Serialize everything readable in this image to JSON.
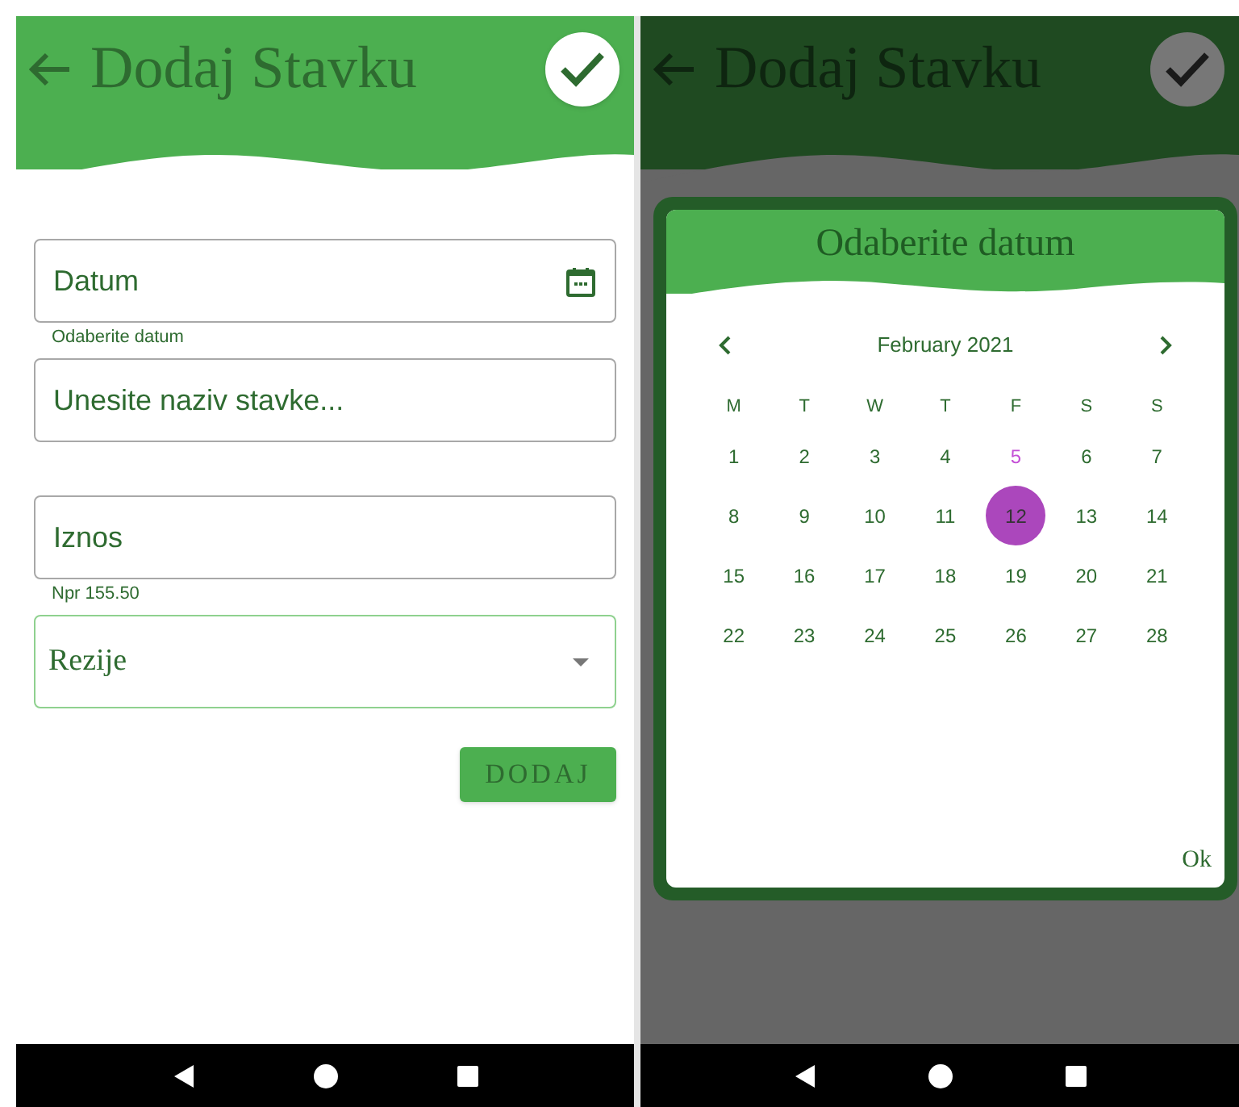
{
  "form_screen": {
    "header": {
      "title": "Dodaj Stavku"
    },
    "fields": [
      {
        "kind": "date",
        "label": "Datum",
        "helper": "Odaberite datum"
      },
      {
        "kind": "text",
        "placeholder": "Unesite naziv stavke..."
      },
      {
        "kind": "text",
        "label": "Iznos",
        "helper": "Npr 155.50"
      },
      {
        "kind": "select",
        "value": "Rezije"
      }
    ],
    "submit_button": "DODAJ"
  },
  "dialog_screen": {
    "header": {
      "title": "Dodaj Stavku"
    },
    "dialog": {
      "title": "Odaberite datum",
      "month": "February 2021",
      "weekdays": [
        "M",
        "T",
        "W",
        "T",
        "F",
        "S",
        "S"
      ],
      "days": [
        {
          "label": "1",
          "today": false,
          "selected": false
        },
        {
          "label": "2",
          "today": false,
          "selected": false
        },
        {
          "label": "3",
          "today": false,
          "selected": false
        },
        {
          "label": "4",
          "today": false,
          "selected": false
        },
        {
          "label": "5",
          "today": true,
          "selected": false
        },
        {
          "label": "6",
          "today": false,
          "selected": false
        },
        {
          "label": "7",
          "today": false,
          "selected": false
        },
        {
          "label": "8",
          "today": false,
          "selected": false
        },
        {
          "label": "9",
          "today": false,
          "selected": false
        },
        {
          "label": "10",
          "today": false,
          "selected": false
        },
        {
          "label": "11",
          "today": false,
          "selected": false
        },
        {
          "label": "12",
          "today": false,
          "selected": true
        },
        {
          "label": "13",
          "today": false,
          "selected": false
        },
        {
          "label": "14",
          "today": false,
          "selected": false
        },
        {
          "label": "15",
          "today": false,
          "selected": false
        },
        {
          "label": "16",
          "today": false,
          "selected": false
        },
        {
          "label": "17",
          "today": false,
          "selected": false
        },
        {
          "label": "18",
          "today": false,
          "selected": false
        },
        {
          "label": "19",
          "today": false,
          "selected": false
        },
        {
          "label": "20",
          "today": false,
          "selected": false
        },
        {
          "label": "21",
          "today": false,
          "selected": false
        },
        {
          "label": "22",
          "today": false,
          "selected": false
        },
        {
          "label": "23",
          "today": false,
          "selected": false
        },
        {
          "label": "24",
          "today": false,
          "selected": false
        },
        {
          "label": "25",
          "today": false,
          "selected": false
        },
        {
          "label": "26",
          "today": false,
          "selected": false
        },
        {
          "label": "27",
          "today": false,
          "selected": false
        },
        {
          "label": "28",
          "today": false,
          "selected": false
        }
      ],
      "ok_button": "Ok"
    }
  }
}
